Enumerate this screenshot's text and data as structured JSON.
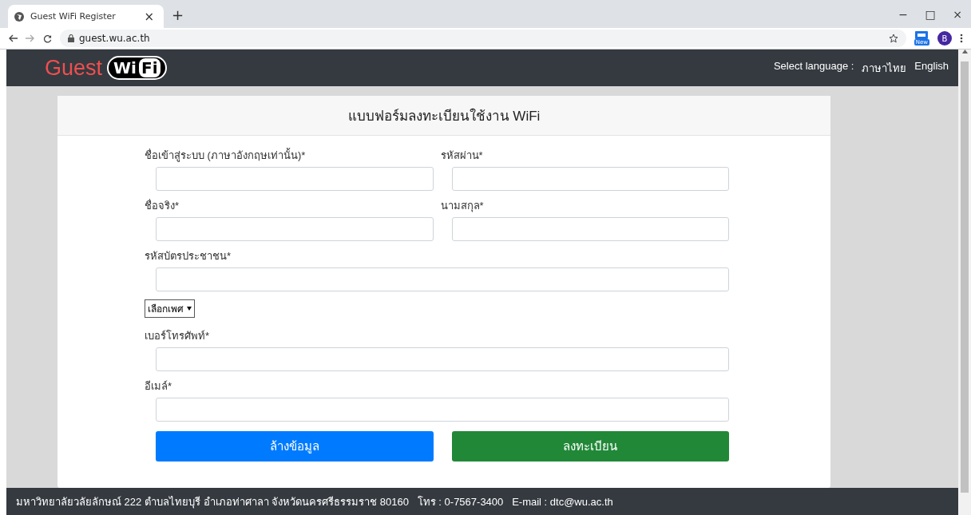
{
  "browser": {
    "tab_title": "Guest WiFi Register",
    "tab_close": "×",
    "new_tab": "+",
    "url": "guest.wu.ac.th",
    "extension_badge": "New",
    "profile_initial": "B",
    "window_controls": [
      "−",
      "□",
      "×"
    ]
  },
  "navbar": {
    "logo_text": "Guest",
    "logo_badge_1": "Wi",
    "logo_badge_2": "Fi",
    "language_label": "Select language :",
    "languages": [
      "ภาษาไทย",
      "English"
    ]
  },
  "form": {
    "title": "แบบฟอร์มลงทะเบียนใช้งาน WiFi",
    "rows": [
      {
        "fields": [
          {
            "kind": "text",
            "label": "ชื่อเข้าสู่ระบบ (ภาษาอังกฤษเท่านั้น)*"
          },
          {
            "kind": "text",
            "label": "รหัสผ่าน*"
          }
        ]
      },
      {
        "fields": [
          {
            "kind": "text",
            "label": "ชื่อจริง*"
          },
          {
            "kind": "text",
            "label": "นามสกุล*"
          }
        ]
      },
      {
        "fields": [
          {
            "kind": "text",
            "label": "รหัสบัตรประชาชน*"
          }
        ]
      },
      {
        "fields": [
          {
            "kind": "select",
            "value": "เลือกเพศ"
          }
        ]
      },
      {
        "fields": [
          {
            "kind": "text",
            "label": "เบอร์โทรศัพท์*"
          }
        ]
      },
      {
        "fields": [
          {
            "kind": "text",
            "label": "อีเมล์*"
          }
        ]
      }
    ],
    "buttons": [
      {
        "label": "ล้างข้อมูล",
        "color": "#007bff"
      },
      {
        "label": "ลงทะเบียน",
        "color": "#218838"
      }
    ]
  },
  "footer": "มหาวิทยาลัยวลัยลักษณ์ 222 ตำบลไทยบุรี อำเภอท่าศาลา จังหวัดนครศรีธรรมราช 80160   โทร : 0-7567-3400   E-mail : dtc@wu.ac.th"
}
